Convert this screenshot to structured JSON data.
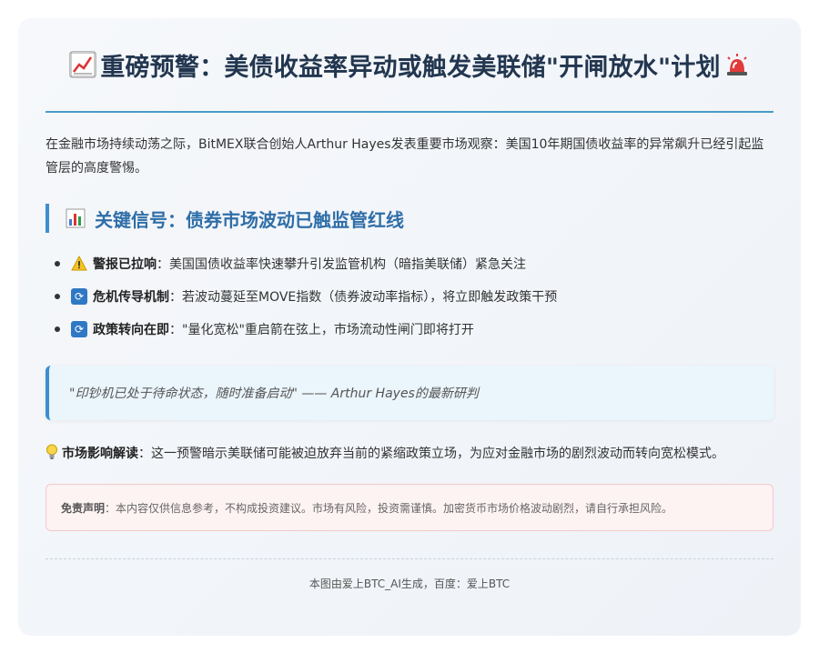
{
  "title": {
    "lead_icon": "chart-increasing-emoji",
    "text": "重磅预警：美债收益率异动或触发美联储\"开闸放水\"计划",
    "trail_icon": "rotating-light-emoji"
  },
  "intro": "在金融市场持续动荡之际，BitMEX联合创始人Arthur Hayes发表重要市场观察：美国10年期国债收益率的异常飙升已经引起监管层的高度警惕。",
  "section": {
    "icon": "bar-chart-emoji",
    "title": "关键信号：债券市场波动已触监管红线"
  },
  "bullets": [
    {
      "icon": "warning-emoji",
      "label": "警报已拉响",
      "text": "：美国国债收益率快速攀升引发监管机构（暗指美联储）紧急关注"
    },
    {
      "icon": "cycle-arrows-emoji",
      "label": "危机传导机制",
      "text": "：若波动蔓延至MOVE指数（债券波动率指标），将立即触发政策干预"
    },
    {
      "icon": "cycle-arrows-emoji",
      "label": "政策转向在即",
      "text": "：\"量化宽松\"重启箭在弦上，市场流动性闸门即将打开"
    }
  ],
  "quote": "\"印钞机已处于待命状态，随时准备启动\" —— Arthur Hayes的最新研判",
  "impact": {
    "icon": "light-bulb-emoji",
    "label": "市场影响解读",
    "text": "：这一预警暗示美联储可能被迫放弃当前的紧缩政策立场，为应对金融市场的剧烈波动而转向宽松模式。"
  },
  "disclaimer": {
    "label": "免责声明",
    "text": "：本内容仅供信息参考，不构成投资建议。市场有风险，投资需谨慎。加密货币市场价格波动剧烈，请自行承担风险。"
  },
  "footer": "本图由爱上BTC_AI生成，百度：爱上BTC",
  "colors": {
    "title": "#22364f",
    "accent": "#3b8fd0",
    "section_title": "#2f6ea8",
    "quote_bg": "#eaf5fc",
    "disclaimer_bg": "#fdf3f3"
  }
}
